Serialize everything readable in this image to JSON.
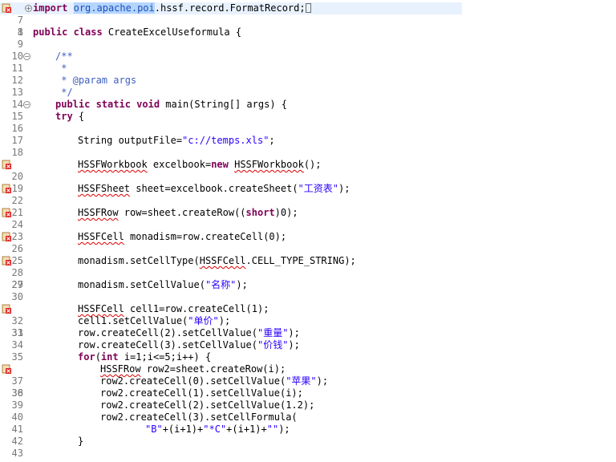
{
  "editor": {
    "lines": {
      "l1": {
        "num": "1",
        "kw": "import",
        "sel": "org.apache.poi",
        "rest": ".hssf.record.FormatRecord;"
      },
      "l7": {
        "num": "7"
      },
      "l8": {
        "num": "8",
        "kw": "public class",
        "rest": " CreateExcelUseformula {"
      },
      "l9": {
        "num": "9"
      },
      "l10": {
        "num": "10",
        "doc": "/**"
      },
      "l11": {
        "num": "11",
        "doc": " *"
      },
      "l12": {
        "num": "12",
        "doc": " * @param args"
      },
      "l13": {
        "num": "13",
        "doc": " */"
      },
      "l14": {
        "num": "14",
        "kw": "public static void",
        "rest": " main(String[] args) {"
      },
      "l15": {
        "num": "15",
        "kw": "try",
        "rest": " {"
      },
      "l16": {
        "num": "16"
      },
      "l17": {
        "num": "17",
        "a": "String outputFile=",
        "str": "\"c://temps.xls\"",
        "b": ";"
      },
      "l18": {
        "num": "18"
      },
      "l19": {
        "num": "19",
        "e1": "HSSFWorkbook",
        "a": " excelbook=",
        "kw": "new",
        "e2": "HSSFWorkbook",
        "b": "();"
      },
      "l20": {
        "num": "20"
      },
      "l21": {
        "num": "21",
        "e1": "HSSFSheet",
        "a": " sheet=excelbook.createSheet(",
        "str": "\"工资表\"",
        "b": ");"
      },
      "l22": {
        "num": "22"
      },
      "l23": {
        "num": "23",
        "e1": "HSSFRow",
        "a": " row=sheet.createRow((",
        "kw": "short",
        "b": ")0);"
      },
      "l24": {
        "num": "24"
      },
      "l25": {
        "num": "25",
        "e1": "HSSFCell",
        "a": " monadism=row.createCell(0);"
      },
      "l26": {
        "num": "26"
      },
      "l27": {
        "num": "27",
        "a": "monadism.setCellType(",
        "e1": "HSSFCell",
        "b": ".CELL_TYPE_STRING);"
      },
      "l28": {
        "num": "28"
      },
      "l29": {
        "num": "29",
        "a": "monadism.setCellValue(",
        "str": "\"名称\"",
        "b": ");"
      },
      "l30": {
        "num": "30"
      },
      "l31": {
        "num": "31",
        "e1": "HSSFCell",
        "a": " cell1=row.createCell(1);"
      },
      "l32": {
        "num": "32",
        "a": "cell1.setCellValue(",
        "str": "\"单价\"",
        "b": ");"
      },
      "l33": {
        "num": "33",
        "a": "row.createCell(2).setCellValue(",
        "str": "\"重量\"",
        "b": ");"
      },
      "l34": {
        "num": "34",
        "a": "row.createCell(3).setCellValue(",
        "str": "\"价钱\"",
        "b": ");"
      },
      "l35": {
        "num": "35",
        "kw": "for",
        "a": "(",
        "kw2": "int",
        "b": " i=1;i<=5;i++) {"
      },
      "l36": {
        "num": "36",
        "e1": "HSSFRow",
        "a": " row2=sheet.createRow(i);"
      },
      "l37": {
        "num": "37",
        "a": "row2.createCell(0).setCellValue(",
        "str": "\"苹果\"",
        "b": ");"
      },
      "l38": {
        "num": "38",
        "a": "row2.createCell(1).setCellValue(i);"
      },
      "l39": {
        "num": "39",
        "a": "row2.createCell(2).setCellValue(1.2);"
      },
      "l40": {
        "num": "40",
        "a": "row2.createCell(3).setCellFormula("
      },
      "l41": {
        "num": "41",
        "str": "\"B\"",
        "a": "+(i+1)+",
        "str2": "\"*C\"",
        "b": "+(i+1)+",
        "str3": "\"\"",
        "c": ");"
      },
      "l42": {
        "num": "42",
        "a": "}"
      },
      "l43": {
        "num": "43"
      }
    }
  }
}
